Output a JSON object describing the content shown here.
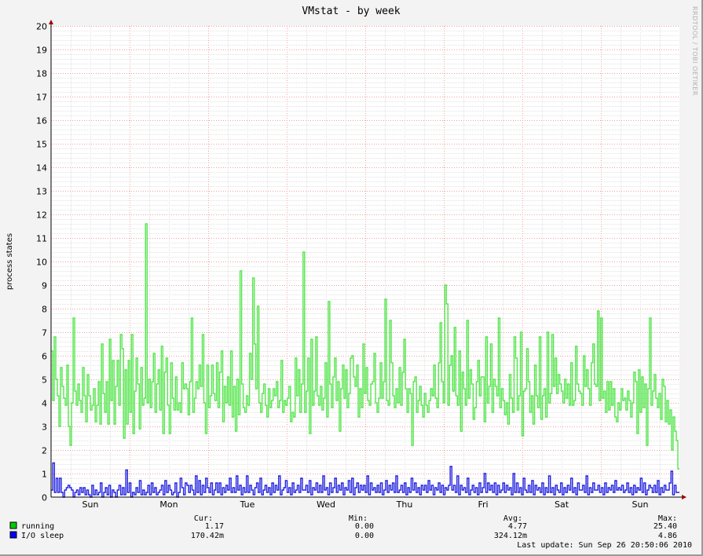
{
  "chart_data": {
    "type": "line",
    "title": "VMstat - by week",
    "ylabel": "process states",
    "ylim": [
      0,
      20
    ],
    "yticks": [
      0,
      1,
      2,
      3,
      4,
      5,
      6,
      7,
      8,
      9,
      10,
      11,
      12,
      13,
      14,
      15,
      16,
      17,
      18,
      19,
      20
    ],
    "xlabels": [
      "Sun",
      "Mon",
      "Tue",
      "Wed",
      "Thu",
      "Fri",
      "Sat",
      "Sun"
    ],
    "grid": true,
    "watermark": "RRDTOOL / TOBI OETIKER",
    "series": [
      {
        "name": "running",
        "color": "#55e64d",
        "swatch": "#00cc00",
        "cur": "1.17",
        "min": "0.00",
        "avg": "4.77",
        "max": "25.40",
        "values": [
          6.2,
          4.1,
          6.8,
          5.0,
          4.3,
          3.0,
          5.5,
          4.7,
          4.2,
          3.9,
          5.6,
          3.0,
          2.2,
          4.0,
          7.6,
          4.5,
          3.9,
          4.8,
          4.1,
          3.6,
          5.5,
          4.3,
          3.2,
          5.2,
          4.3,
          3.7,
          3.9,
          4.6,
          3.2,
          3.9,
          4.9,
          3.1,
          6.5,
          4.4,
          3.6,
          4.9,
          3.1,
          6.7,
          4.1,
          5.8,
          3.1,
          4.7,
          5.8,
          3.9,
          6.9,
          6.3,
          2.5,
          5.4,
          3.1,
          5.8,
          3.6,
          6.9,
          2.7,
          4.5,
          5.9,
          4.8,
          2.9,
          5.5,
          3.9,
          4.2,
          11.6,
          4.0,
          5.0,
          3.8,
          4.9,
          6.1,
          3.6,
          4.8,
          5.4,
          3.7,
          6.4,
          2.7,
          5.3,
          5.9,
          3.9,
          2.7,
          5.7,
          4.2,
          3.7,
          5.1,
          3.7,
          4.0,
          3.6,
          5.7,
          4.6,
          4.8,
          4.6,
          3.5,
          4.9,
          7.6,
          3.6,
          4.2,
          4.9,
          4.6,
          5.6,
          4.7,
          6.9,
          4.0,
          2.7,
          5.6,
          3.8,
          4.3,
          5.6,
          4.4,
          4.1,
          5.7,
          3.8,
          5.3,
          6.2,
          3.2,
          4.7,
          4.0,
          5.1,
          3.9,
          6.2,
          3.4,
          4.7,
          2.8,
          5.0,
          3.5,
          9.6,
          4.8,
          3.8,
          3.6,
          4.3,
          3.9,
          6.1,
          5.0,
          9.3,
          6.5,
          4.6,
          8.1,
          4.0,
          3.6,
          4.4,
          4.8,
          3.9,
          3.4,
          4.6,
          3.8,
          4.1,
          4.6,
          4.3,
          4.9,
          3.8,
          4.1,
          5.8,
          3.6,
          4.1,
          3.9,
          4.2,
          4.7,
          3.2,
          3.6,
          3.4,
          5.9,
          4.3,
          5.4,
          3.6,
          4.8,
          10.4,
          3.6,
          4.5,
          5.9,
          2.7,
          6.7,
          3.9,
          4.5,
          6.8,
          4.3,
          3.9,
          4.7,
          3.7,
          4.2,
          5.7,
          3.4,
          8.3,
          4.8,
          3.8,
          5.1,
          5.9,
          4.1,
          4.9,
          2.8,
          4.6,
          5.6,
          4.2,
          5.4,
          3.8,
          4.4,
          5.9,
          6.0,
          5.1,
          4.7,
          5.6,
          3.4,
          4.6,
          3.8,
          6.5,
          4.4,
          5.5,
          4.1,
          3.9,
          4.8,
          4.9,
          6.1,
          4.0,
          3.6,
          4.2,
          5.7,
          4.2,
          4.9,
          8.4,
          4.1,
          3.9,
          7.5,
          5.7,
          4.3,
          3.8,
          4.6,
          4.0,
          5.5,
          3.9,
          5.3,
          6.7,
          4.6,
          3.6,
          4.6,
          4.4,
          2.2,
          4.9,
          5.1,
          3.6,
          4.1,
          4.7,
          3.9,
          3.4,
          4.4,
          3.9,
          3.6,
          4.1,
          4.6,
          4.3,
          5.6,
          4.2,
          3.8,
          5.7,
          7.4,
          4.9,
          4.0,
          9.0,
          8.2,
          3.9,
          5.6,
          6.0,
          4.5,
          7.2,
          4.3,
          3.9,
          6.2,
          2.8,
          5.3,
          4.6,
          3.9,
          7.5,
          4.2,
          5.4,
          4.8,
          3.3,
          3.8,
          4.9,
          5.8,
          4.3,
          5.1,
          5.1,
          3.2,
          6.8,
          4.0,
          4.7,
          6.5,
          3.6,
          5.0,
          4.7,
          4.3,
          7.6,
          3.8,
          4.6,
          4.1,
          3.5,
          4.0,
          3.1,
          5.2,
          4.2,
          3.6,
          6.8,
          5.9,
          3.7,
          4.3,
          7.0,
          2.6,
          4.5,
          4.6,
          6.3,
          4.9,
          3.6,
          4.3,
          3.1,
          5.6,
          4.3,
          3.8,
          6.8,
          3.3,
          4.3,
          4.6,
          3.4,
          7.0,
          4.0,
          4.4,
          6.9,
          4.7,
          5.9,
          4.4,
          5.2,
          4.8,
          4.5,
          4.0,
          5.0,
          4.2,
          4.8,
          3.9,
          5.7,
          3.9,
          4.1,
          6.4,
          4.8,
          4.5,
          4.4,
          3.9,
          6.0,
          4.7,
          5.4,
          4.6,
          3.9,
          5.7,
          6.5,
          4.8,
          4.7,
          7.9,
          4.1,
          7.6,
          4.2,
          4.5,
          3.6,
          4.9,
          3.7,
          4.9,
          3.9,
          4.6,
          3.4,
          3.2,
          4.0,
          3.7,
          4.6,
          4.1,
          4.2,
          3.7,
          4.5,
          4.1,
          3.4,
          4.0,
          5.3,
          4.9,
          2.7,
          5.4,
          3.6,
          5.1,
          3.8,
          4.8,
          2.2,
          4.6,
          7.6,
          3.9,
          4.5,
          5.2,
          4.2,
          3.8,
          4.4,
          3.3,
          5.0,
          4.7,
          3.2,
          4.1,
          3.1,
          3.7,
          2.0,
          3.4,
          2.8,
          2.4,
          1.2
        ]
      },
      {
        "name": "I/O sleep",
        "color": "#2222e0",
        "swatch": "#0000ff",
        "cur": "170.42m",
        "min": "0.00",
        "avg": "324.12m",
        "max": "4.86",
        "values": [
          0.3,
          1.45,
          0.2,
          0.8,
          0.2,
          0.8,
          0.2,
          0.0,
          0.3,
          0.4,
          0.5,
          0.4,
          0.3,
          0.0,
          0.2,
          0.3,
          0.1,
          0.4,
          0.2,
          0.4,
          0.1,
          0.3,
          0.1,
          0.0,
          0.5,
          0.1,
          0.3,
          0.1,
          0.2,
          0.6,
          0.0,
          0.2,
          0.4,
          0.1,
          0.5,
          0.0,
          0.3,
          0.2,
          0.0,
          0.3,
          0.5,
          0.1,
          0.4,
          0.1,
          1.15,
          0.2,
          0.6,
          0.0,
          0.2,
          0.1,
          0.4,
          0.2,
          0.7,
          0.1,
          0.3,
          0.1,
          0.2,
          0.5,
          0.1,
          0.6,
          0.2,
          0.4,
          0.1,
          0.2,
          0.3,
          0.5,
          0.1,
          0.7,
          0.2,
          0.5,
          0.3,
          0.1,
          0.2,
          0.6,
          0.0,
          0.2,
          0.8,
          0.4,
          0.1,
          0.6,
          0.5,
          0.2,
          0.5,
          0.3,
          0.1,
          0.9,
          0.2,
          0.7,
          0.1,
          0.5,
          0.2,
          0.8,
          0.4,
          0.2,
          0.6,
          0.1,
          0.3,
          0.6,
          0.2,
          0.6,
          0.1,
          0.4,
          0.2,
          0.5,
          0.3,
          0.8,
          0.2,
          0.4,
          0.2,
          0.9,
          0.3,
          0.5,
          0.1,
          0.4,
          0.2,
          0.9,
          0.2,
          0.5,
          0.3,
          0.1,
          0.4,
          0.6,
          0.2,
          0.8,
          0.1,
          0.3,
          0.5,
          0.2,
          0.4,
          0.1,
          0.6,
          0.2,
          0.5,
          0.3,
          0.9,
          0.1,
          0.3,
          0.4,
          0.7,
          0.2,
          0.4,
          0.1,
          0.6,
          0.2,
          0.3,
          0.5,
          0.2,
          0.8,
          0.3,
          0.3,
          0.5,
          0.2,
          0.7,
          0.1,
          0.4,
          0.3,
          0.6,
          0.2,
          0.5,
          0.2,
          0.9,
          0.3,
          0.4,
          0.1,
          0.6,
          0.2,
          0.4,
          0.8,
          0.2,
          0.5,
          0.3,
          0.6,
          0.1,
          0.4,
          0.3,
          0.7,
          0.2,
          0.8,
          0.1,
          0.4,
          0.6,
          0.2,
          0.5,
          0.3,
          0.5,
          0.2,
          0.9,
          0.1,
          0.6,
          0.3,
          0.4,
          0.2,
          0.5,
          0.2,
          0.6,
          0.1,
          0.3,
          0.7,
          0.2,
          0.5,
          0.3,
          0.6,
          0.2,
          0.9,
          0.2,
          0.3,
          0.5,
          0.2,
          0.6,
          0.1,
          0.4,
          0.2,
          0.8,
          0.3,
          0.6,
          0.2,
          0.4,
          0.1,
          0.5,
          0.3,
          0.5,
          0.2,
          0.7,
          0.3,
          0.5,
          0.1,
          0.4,
          0.3,
          0.6,
          0.2,
          0.5,
          0.1,
          0.4,
          0.3,
          0.5,
          1.3,
          0.3,
          0.5,
          0.2,
          0.9,
          0.1,
          0.5,
          0.3,
          0.4,
          0.2,
          0.8,
          0.1,
          0.3,
          0.5,
          0.2,
          0.4,
          0.1,
          0.6,
          0.2,
          0.4,
          1.0,
          0.2,
          0.6,
          0.3,
          0.5,
          0.2,
          0.6,
          0.1,
          0.5,
          0.2,
          0.3,
          0.6,
          0.2,
          0.5,
          0.3,
          0.4,
          0.1,
          1.0,
          0.2,
          0.6,
          0.2,
          0.4,
          0.1,
          0.8,
          0.3,
          0.2,
          0.5,
          0.2,
          0.7,
          0.1,
          0.5,
          0.3,
          0.4,
          0.2,
          0.6,
          0.1,
          0.4,
          0.2,
          0.9,
          0.2,
          0.4,
          0.1,
          0.5,
          0.3,
          0.2,
          0.6,
          0.1,
          0.4,
          0.2,
          0.5,
          0.3,
          0.8,
          0.2,
          0.4,
          0.1,
          0.6,
          0.3,
          0.3,
          0.5,
          0.2,
          0.9,
          0.1,
          0.4,
          0.2,
          0.6,
          0.3,
          0.3,
          0.5,
          0.2,
          0.4,
          0.1,
          0.6,
          0.2,
          0.4,
          0.3,
          0.5,
          0.2,
          0.7,
          0.3,
          0.4,
          0.3,
          0.5,
          0.2,
          0.3,
          0.6,
          0.2,
          0.4,
          0.1,
          0.5,
          0.2,
          0.4,
          0.3,
          0.8,
          0.2,
          0.6,
          0.1,
          0.3,
          0.5,
          0.4,
          0.2,
          0.5,
          0.2,
          0.7,
          0.1,
          0.4,
          0.2,
          0.5,
          0.3,
          0.3,
          0.6,
          1.1,
          0.1,
          0.5,
          0.2,
          0.2
        ]
      }
    ],
    "legend_headers": {
      "cur": "Cur:",
      "min": "Min:",
      "avg": "Avg:",
      "max": "Max:"
    },
    "last_update": "Last update:  Sun Sep 26 20:50:06 2010"
  }
}
